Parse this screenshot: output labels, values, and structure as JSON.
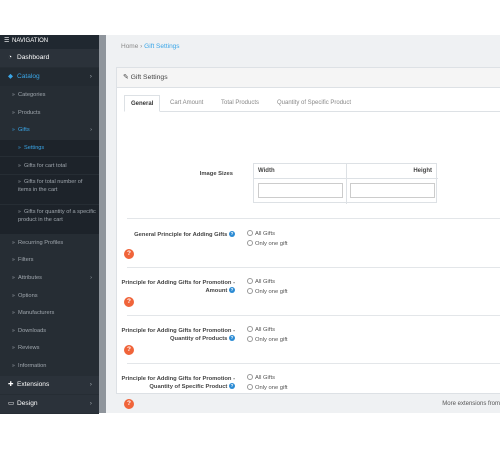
{
  "sidebar": {
    "nav_header": "NAVIGATION",
    "dashboard": "Dashboard",
    "catalog": "Catalog",
    "categories": "Categories",
    "products": "Products",
    "gifts": "Gifts",
    "settings": "Settings",
    "gifts_cart_total": "Gifts for cart total",
    "gifts_total_number": "Gifts for total number of items in the cart",
    "gifts_quantity_specific": "Gifts for quantity of a specific product in the cart",
    "recurring_profiles": "Recurring Profiles",
    "filters": "Filters",
    "attributes": "Attributes",
    "options": "Options",
    "manufacturers": "Manufacturers",
    "downloads": "Downloads",
    "reviews": "Reviews",
    "information": "Information",
    "extensions": "Extensions",
    "design": "Design"
  },
  "breadcrumb": {
    "home": "Home",
    "separator": "›",
    "current": "Gift Settings"
  },
  "panel": {
    "title": "Gift Settings"
  },
  "tabs": [
    "General",
    "Cart Amount",
    "Total Products",
    "Quantity of Specific Product"
  ],
  "image_sizes": {
    "label": "Image Sizes",
    "width_header": "Width",
    "height_header": "Height",
    "width_value": "",
    "height_value": ""
  },
  "settings": [
    {
      "label": "General Principle for Adding Gifts",
      "help": "?",
      "option_all": "All Gifts",
      "option_one": "Only one gift"
    },
    {
      "label": "Principle for Adding Gifts for Promotion - Amount",
      "help": "?",
      "option_all": "All Gifts",
      "option_one": "Only one gift"
    },
    {
      "label": "Principle for Adding Gifts for Promotion - Quantity of Products",
      "help": "?",
      "option_all": "All Gifts",
      "option_one": "Only one gift"
    },
    {
      "label": "Principle for Adding Gifts for Promotion - Quantity of Specific Product",
      "help": "?",
      "option_all": "All Gifts",
      "option_one": "Only one gift"
    }
  ],
  "footer": {
    "text": "More extensions from"
  },
  "colors": {
    "sidebar_bg": "#2f3740",
    "accent": "#3aa6e8",
    "help_orange": "#f0643a",
    "info_blue": "#2b8bd4"
  }
}
